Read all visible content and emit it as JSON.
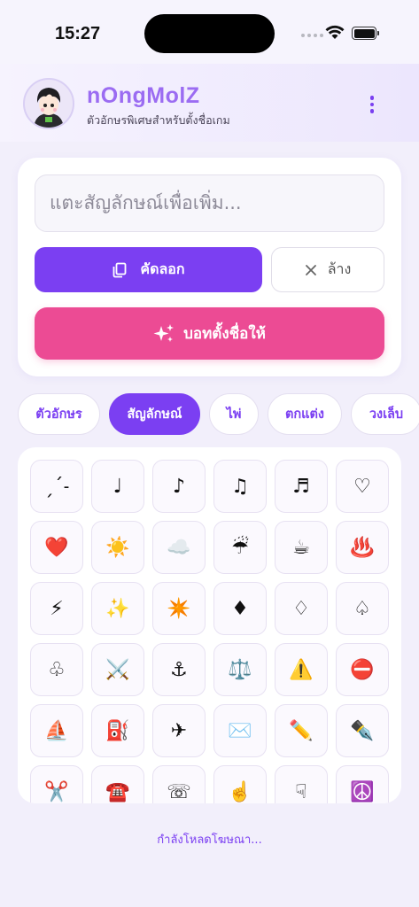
{
  "status_bar": {
    "time": "15:27"
  },
  "header": {
    "title": "nOngMolZ",
    "subtitle": "ตัวอักษรพิเศษสำหรับตั้งชื่อเกม"
  },
  "editor": {
    "placeholder": "แตะสัญลักษณ์เพื่อเพิ่ม...",
    "copy_label": "คัดลอก",
    "clear_label": "ล้าง",
    "suggest_label": "บอทตั้งชื่อให้"
  },
  "tabs": [
    {
      "label": "ตัวอักษร",
      "active": false
    },
    {
      "label": "สัญลักษณ์",
      "active": true
    },
    {
      "label": "ไพ่",
      "active": false
    },
    {
      "label": "ตกแต่ง",
      "active": false
    },
    {
      "label": "วงเล็บ",
      "active": false
    }
  ],
  "symbols": [
    "ˏˊ˗",
    "♩",
    "♪",
    "♫",
    "♬",
    "♡",
    "❤️",
    "☀️",
    "☁️",
    "☔",
    "☕",
    "♨️",
    "⚡",
    "✨",
    "✴️",
    "♦",
    "♢",
    "♤",
    "♧",
    "⚔️",
    "⚓",
    "⚖️",
    "⚠️",
    "⛔",
    "⛵",
    "⛽",
    "✈",
    "✉️",
    "✏️",
    "✒️",
    "✂️",
    "☎️",
    "☏",
    "☝️",
    "☟",
    "☮️"
  ],
  "ad": {
    "loading_text": "กำลังโหลดโฆษณา..."
  },
  "colors": {
    "accent": "#7b3ff2",
    "pink": "#ec4b94",
    "title": "#9b6cf2",
    "background": "#f2effb"
  },
  "icons": {
    "copy": "copy-icon",
    "clear": "close-icon",
    "suggest": "sparkles-icon",
    "menu": "more-vertical-icon"
  }
}
